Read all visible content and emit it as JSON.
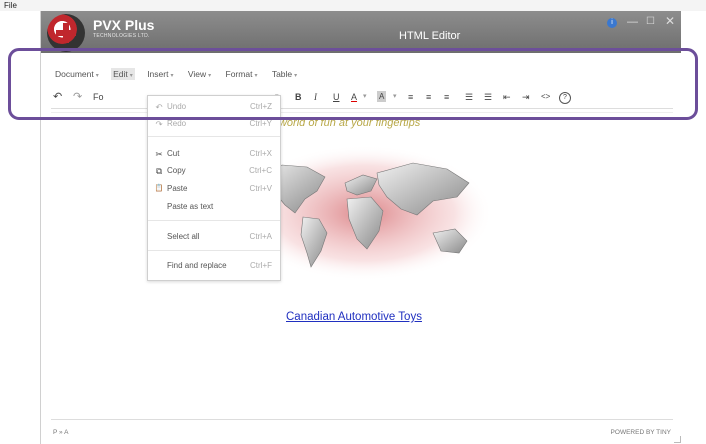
{
  "os_menu": {
    "file_label": "File"
  },
  "titlebar": {
    "brand": "PVX Plus",
    "brand_sub": "TECHNOLOGIES LTD.",
    "title": "HTML Editor",
    "info_glyph": "i",
    "min_glyph": "—",
    "max_glyph": "☐",
    "close_glyph": "✕"
  },
  "menubar": {
    "items": [
      {
        "label": "Document"
      },
      {
        "label": "Edit"
      },
      {
        "label": "Insert"
      },
      {
        "label": "View"
      },
      {
        "label": "Format"
      },
      {
        "label": "Table"
      }
    ],
    "caret": "▾"
  },
  "toolbar": {
    "undo_glyph": "↶",
    "redo_glyph": "↷",
    "font_label": "Fo",
    "dropdown_caret": "▾",
    "bold": "B",
    "italic": "I",
    "underline": "U",
    "font_color": "A",
    "bg_color": "A",
    "align_left": "≡",
    "align_center": "≡",
    "align_right": "≡",
    "bullet_list": "☰",
    "numbered_list": "☰",
    "outdent": "⇤",
    "indent": "⇥",
    "code": "<>",
    "help": "?"
  },
  "content": {
    "tagline": "A world of fun at your fingertips",
    "link_text": "Canadian Automotive Toys"
  },
  "statusbar": {
    "path": "P » A",
    "powered_by": "POWERED BY TINY"
  },
  "edit_menu": {
    "items": [
      {
        "icon": "↶",
        "label": "Undo",
        "shortcut": "Ctrl+Z",
        "disabled": true
      },
      {
        "icon": "↷",
        "label": "Redo",
        "shortcut": "Ctrl+Y",
        "disabled": true
      },
      {
        "icon": "✂",
        "label": "Cut",
        "shortcut": "Ctrl+X"
      },
      {
        "icon": "⧉",
        "label": "Copy",
        "shortcut": "Ctrl+C"
      },
      {
        "icon": "📋",
        "label": "Paste",
        "shortcut": "Ctrl+V"
      },
      {
        "icon": "",
        "label": "Paste as text",
        "shortcut": ""
      },
      {
        "icon": "",
        "label": "Select all",
        "shortcut": "Ctrl+A"
      },
      {
        "icon": "",
        "label": "Find and replace",
        "shortcut": "Ctrl+F"
      }
    ]
  },
  "colors": {
    "titlebar": "#7d7d7d",
    "highlight_border": "#6c4e9a",
    "link": "#2030c0",
    "tagline": "#b8a848",
    "map_red": "#c0272d"
  }
}
